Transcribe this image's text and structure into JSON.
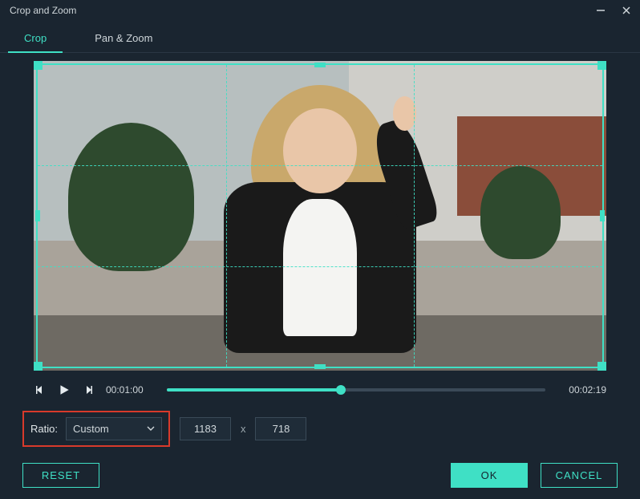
{
  "window": {
    "title": "Crop and Zoom"
  },
  "tabs": {
    "crop": "Crop",
    "panzoom": "Pan & Zoom"
  },
  "playback": {
    "current": "00:01:00",
    "duration": "00:02:19"
  },
  "ratio": {
    "label": "Ratio:",
    "selected": "Custom",
    "width": "1183",
    "sep": "x",
    "height": "718"
  },
  "buttons": {
    "reset": "RESET",
    "ok": "OK",
    "cancel": "CANCEL"
  }
}
